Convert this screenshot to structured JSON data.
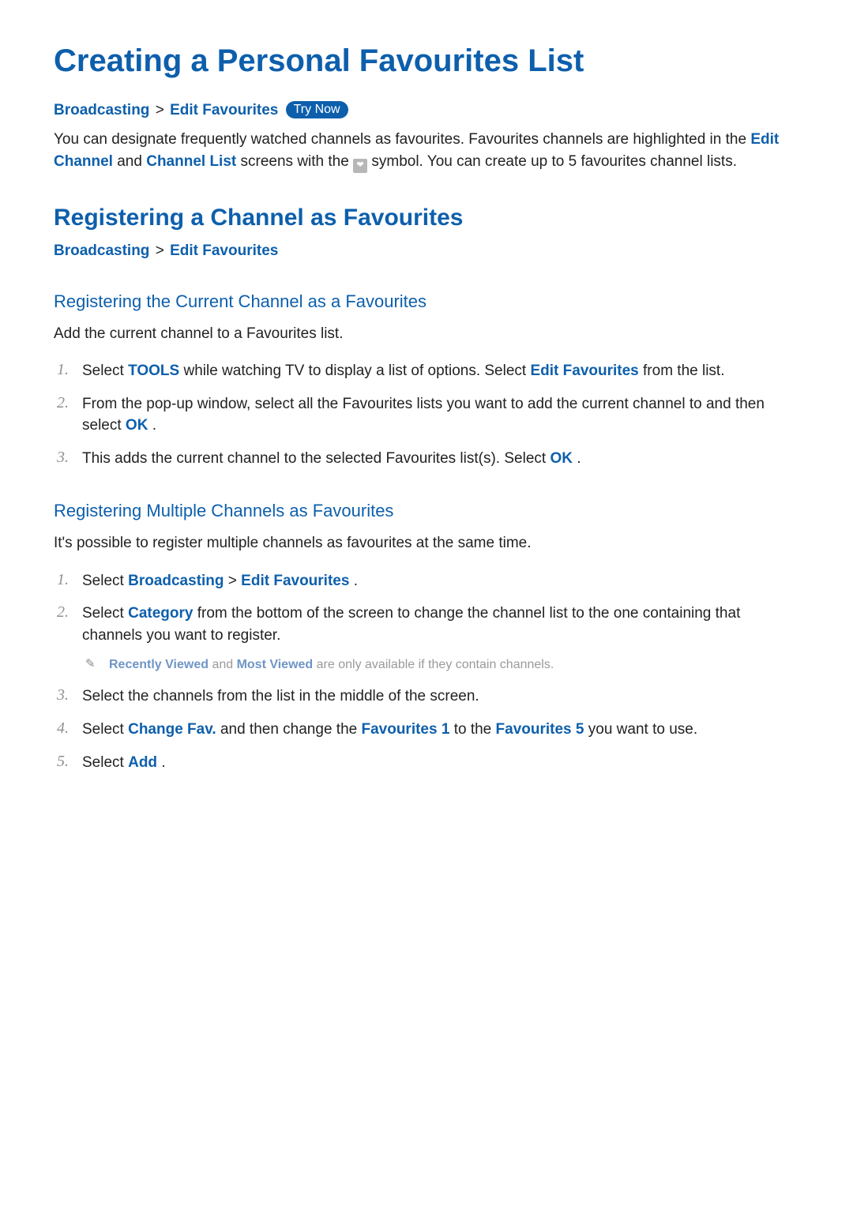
{
  "title": "Creating a Personal Favourites List",
  "breadcrumb1": {
    "a": "Broadcasting",
    "sep": ">",
    "b": "Edit Favourites",
    "tryNow": "Try Now"
  },
  "intro": {
    "pre": "You can designate frequently watched channels as favourites. Favourites channels are highlighted in the ",
    "editChannel": "Edit Channel",
    "and": " and ",
    "channelList": "Channel List",
    "mid": " screens with the ",
    "heart": "❤",
    "post": " symbol. You can create up to 5 favourites channel lists."
  },
  "section2": {
    "title": "Registering a Channel as Favourites",
    "bc": {
      "a": "Broadcasting",
      "sep": ">",
      "b": "Edit Favourites"
    }
  },
  "section3": {
    "title": "Registering the Current Channel as a Favourites",
    "lead": "Add the current channel to a Favourites list.",
    "steps": {
      "s1": {
        "t1": "Select ",
        "tools": "TOOLS",
        "t2": " while watching TV to display a list of options. Select ",
        "ef": "Edit Favourites",
        "t3": " from the list."
      },
      "s2": {
        "t1": "From the pop-up window, select all the Favourites lists you want to add the current channel to and then select ",
        "ok": "OK",
        "t2": "."
      },
      "s3": {
        "t1": "This adds the current channel to the selected Favourites list(s). Select ",
        "ok": "OK",
        "t2": "."
      }
    }
  },
  "section4": {
    "title": "Registering Multiple Channels as Favourites",
    "lead": "It's possible to register multiple channels as favourites at the same time.",
    "steps": {
      "s1": {
        "t1": "Select ",
        "b1": "Broadcasting",
        "sep": " > ",
        "b2": "Edit Favourites",
        "t2": "."
      },
      "s2": {
        "t1": "Select ",
        "cat": "Category",
        "t2": " from the bottom of the screen to change the channel list to the one containing that channels you want to register."
      },
      "note": {
        "pen": "✎",
        "rv": "Recently Viewed",
        "and": " and ",
        "mv": "Most Viewed",
        "rest": " are only available if they contain channels."
      },
      "s3": "Select the channels from the list in the middle of the screen.",
      "s4": {
        "t1": "Select ",
        "cf": "Change Fav.",
        "t2": " and then change the ",
        "f1": "Favourites 1",
        "t3": " to the ",
        "f5": "Favourites 5",
        "t4": " you want to use."
      },
      "s5": {
        "t1": "Select ",
        "add": "Add",
        "t2": "."
      }
    }
  }
}
